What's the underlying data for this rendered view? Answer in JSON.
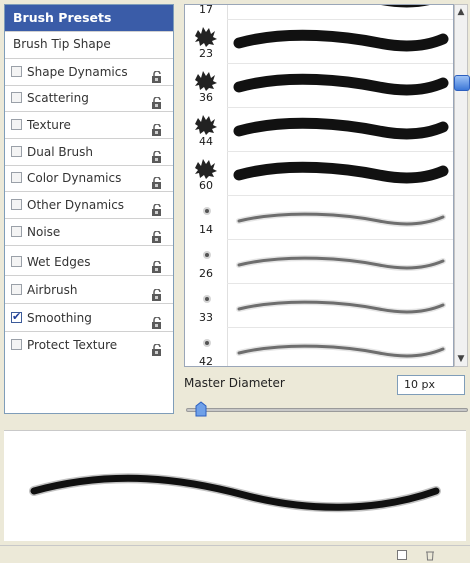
{
  "settings": {
    "header": "Brush Presets",
    "tip_shape": "Brush Tip Shape",
    "options": [
      {
        "label": "Shape Dynamics",
        "checked": false
      },
      {
        "label": "Scattering",
        "checked": false
      },
      {
        "label": "Texture",
        "checked": false
      },
      {
        "label": "Dual Brush",
        "checked": false
      },
      {
        "label": "Color Dynamics",
        "checked": false
      },
      {
        "label": "Other Dynamics",
        "checked": false
      },
      {
        "label": "Noise",
        "checked": false
      },
      {
        "label": "Wet Edges",
        "checked": false
      },
      {
        "label": "Airbrush",
        "checked": false
      },
      {
        "label": "Smoothing",
        "checked": true
      },
      {
        "label": "Protect Texture",
        "checked": false
      }
    ],
    "icons": {
      "checkbox": "checkbox-icon",
      "lock": "lock-icon"
    }
  },
  "presets": [
    {
      "size": "17",
      "kind": "rough"
    },
    {
      "size": "23",
      "kind": "rough"
    },
    {
      "size": "36",
      "kind": "rough"
    },
    {
      "size": "44",
      "kind": "rough"
    },
    {
      "size": "60",
      "kind": "rough"
    },
    {
      "size": "14",
      "kind": "soft"
    },
    {
      "size": "26",
      "kind": "soft"
    },
    {
      "size": "33",
      "kind": "soft"
    },
    {
      "size": "42",
      "kind": "soft"
    }
  ],
  "master_diameter": {
    "label": "Master Diameter",
    "value": "10 px",
    "slider_fraction": 0.03
  },
  "colors": {
    "header_bg": "#3a5ca8",
    "scroll_thumb": "#3c78d8",
    "stroke": "#111111"
  }
}
